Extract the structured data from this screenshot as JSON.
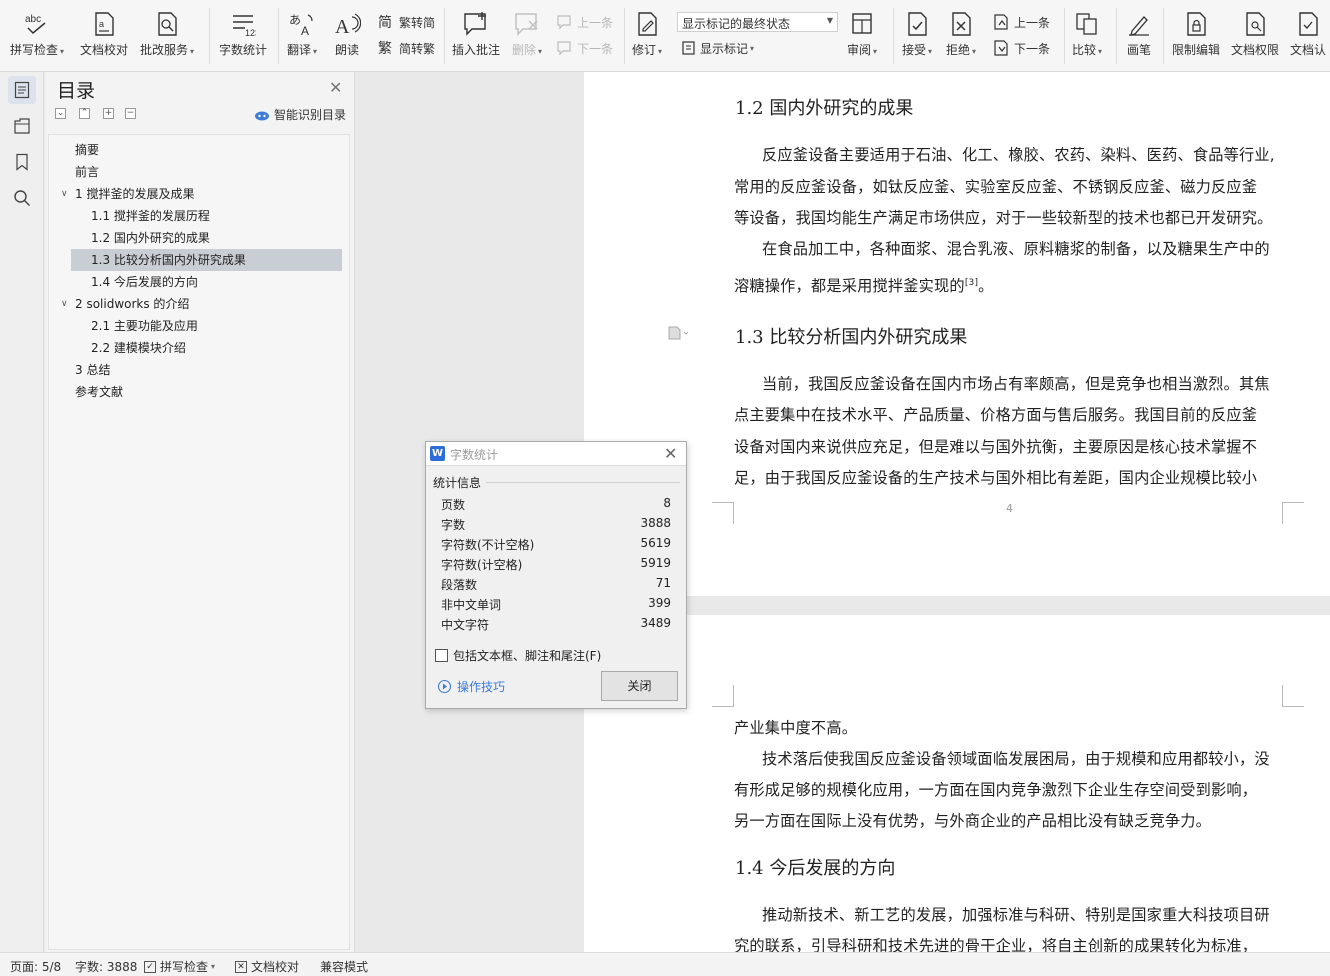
{
  "ribbon": {
    "spell_check": "拼写检查",
    "doc_proof": "文档校对",
    "batch_service": "批改服务",
    "word_count": "字数统计",
    "translate": "翻译",
    "read_aloud": "朗读",
    "to_traditional": "繁转简",
    "to_simplified": "简转繁",
    "insert_comment": "插入批注",
    "delete": "删除",
    "prev_comment": "上一条",
    "next_comment": "下一条",
    "track_changes": "修订",
    "markup_select": "显示标记的最终状态",
    "show_markup": "显示标记",
    "review": "审阅",
    "accept": "接受",
    "reject": "拒绝",
    "prev_change": "上一条",
    "next_change": "下一条",
    "compare": "比较",
    "ink": "画笔",
    "restrict_edit": "限制编辑",
    "doc_permission": "文档权限",
    "doc_cert": "文档认"
  },
  "toc": {
    "title": "目录",
    "smart_label": "智能识别目录",
    "items": [
      {
        "label": "摘要"
      },
      {
        "label": "前言"
      },
      {
        "label": "1 搅拌釜的发展及成果"
      },
      {
        "label": "1.1  搅拌釜的发展历程"
      },
      {
        "label": "1.2  国内外研究的成果"
      },
      {
        "label": "1.3  比较分析国内外研究成果"
      },
      {
        "label": "1.4  今后发展的方向"
      },
      {
        "label": "2 solidworks 的介绍"
      },
      {
        "label": "2.1  主要功能及应用"
      },
      {
        "label": "2.2  建模模块介绍"
      },
      {
        "label": "3  总结"
      },
      {
        "label": "参考文献"
      }
    ]
  },
  "document": {
    "h12": "1.2  国内外研究的成果",
    "p1": [
      "反应釜设备主要适用于石油、化工、橡胶、农药、染料、医药、食品等行业,",
      "常用的反应釜设备，如钛反应釜、实验室反应釜、不锈钢反应釜、磁力反应釜",
      "等设备，我国均能生产满足市场供应，对于一些较新型的技术也都已开发研究。"
    ],
    "p2": [
      "在食品加工中，各种面浆、混合乳液、原料糖浆的制备，以及糖果生产中的",
      "溶糖操作，都是采用搅拌釜实现的"
    ],
    "cite": "[3]",
    "p2_end": "。",
    "h13": "1.3  比较分析国内外研究成果",
    "p3": [
      "当前，我国反应釜设备在国内市场占有率颇高，但是竞争也相当激烈。其焦",
      "点主要集中在技术水平、产品质量、价格方面与售后服务。我国目前的反应釜",
      "设备对国内来说供应充足，但是难以与国外抗衡，主要原因是核心技术掌握不",
      "足，由于我国反应釜设备的生产技术与国外相比有差距，国内企业规模比较小"
    ],
    "page_number": "4",
    "p4": [
      "产业集中度不高。",
      "技术落后使我国反应釜设备领域面临发展困局，由于规模和应用都较小，没",
      "有形成足够的规模化应用，一方面在国内竞争激烈下企业生存空间受到影响，",
      "另一方面在国际上没有优势，与外商企业的产品相比没有缺乏竞争力。"
    ],
    "h14": "1.4  今后发展的方向",
    "p5": [
      "推动新技术、新工艺的发展，加强标准与科研、特别是国家重大科技项目研",
      "究的联系，引导科研和技术先进的骨干企业，将自主创新的成果转化为标准，"
    ]
  },
  "dialog": {
    "title": "字数统计",
    "section": "统计信息",
    "rows": [
      {
        "label": "页数",
        "value": "8"
      },
      {
        "label": "字数",
        "value": "3888"
      },
      {
        "label": "字符数(不计空格)",
        "value": "5619"
      },
      {
        "label": "字符数(计空格)",
        "value": "5919"
      },
      {
        "label": "段落数",
        "value": "71"
      },
      {
        "label": "非中文单词",
        "value": "399"
      },
      {
        "label": "中文字符",
        "value": "3489"
      }
    ],
    "checkbox_label": "包括文本框、脚注和尾注(F)",
    "tips": "操作技巧",
    "close": "关闭"
  },
  "status": {
    "page": "页面: 5/8",
    "words": "字数: 3888",
    "spell": "拼写检查",
    "proof": "文档校对",
    "compat": "兼容模式"
  },
  "colors": {
    "accent": "#3d7bd9",
    "toc_selected": "#c9cdd4",
    "ribbon_bg": "#f6f6f6"
  }
}
